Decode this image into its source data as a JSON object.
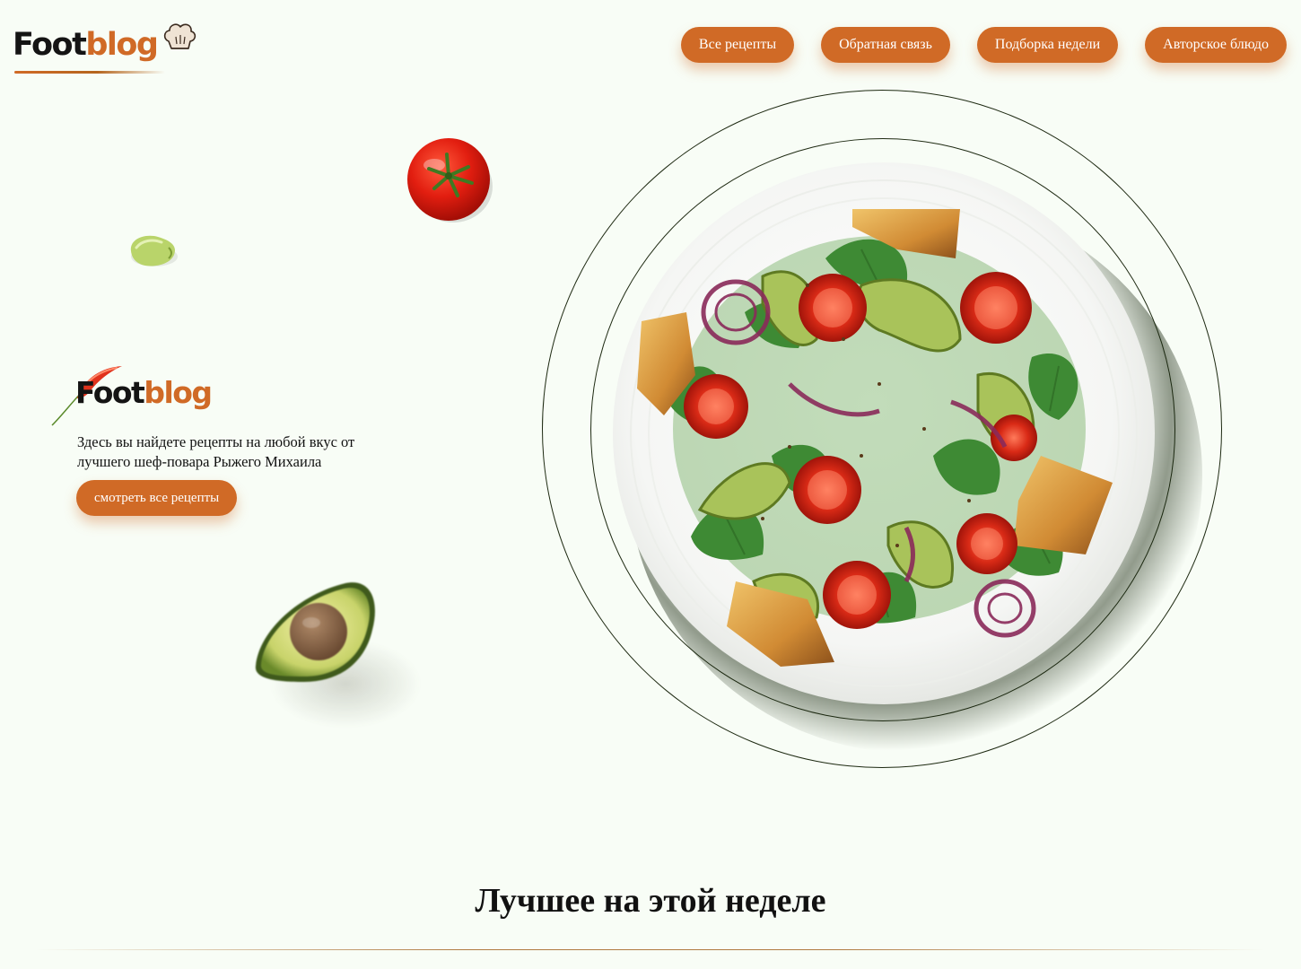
{
  "header": {
    "logo": {
      "part1": "Foot",
      "part2": "blog"
    },
    "nav": [
      {
        "label": "Все рецепты"
      },
      {
        "label": "Обратная связь"
      },
      {
        "label": "Подборка недели"
      },
      {
        "label": "Авторское блюдо"
      }
    ]
  },
  "hero": {
    "logo": {
      "part1": "Foot",
      "part2": "blog"
    },
    "description": "Здесь вы найдете рецепты на любой вкус от лучшего шеф-повара Рыжего Михаила",
    "cta_label": "смотреть все рецепты"
  },
  "section": {
    "title": "Лучшее на этой неделе"
  },
  "colors": {
    "accent": "#d06a26",
    "background": "#f8fdf6",
    "text": "#111111"
  },
  "icons": [
    "chef-hat-icon",
    "chili-icon",
    "tomato-image",
    "bean-image",
    "avocado-image",
    "salad-plate-image"
  ]
}
